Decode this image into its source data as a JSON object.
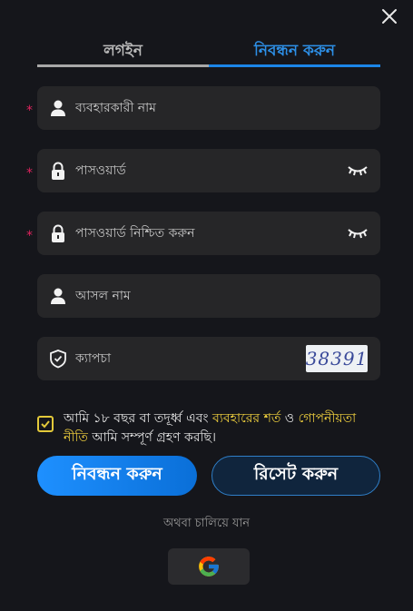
{
  "tabs": {
    "login": "লগইন",
    "register": "নিবন্ধন করুন"
  },
  "fields": {
    "username_placeholder": "ব্যবহারকারী নাম",
    "password_placeholder": "পাসওয়ার্ড",
    "confirm_password_placeholder": "পাসওয়ার্ড নিশ্চিত করুন",
    "real_name_placeholder": "আসল নাম",
    "captcha_placeholder": "ক্যাপচা",
    "captcha_code": "38391",
    "required_mark": "*"
  },
  "agreement": {
    "checked": true,
    "text_before": "আমি ১৮ বছর বা তদূর্ধ্ব এবং ",
    "terms_link": "ব্যবহারের শর্ত",
    "text_and": " ও ",
    "privacy_link_a": "গোপনীয়তা",
    "privacy_link_b": "নীতি",
    "text_after": " আমি সম্পূর্ণ গ্রহণ করছি।"
  },
  "buttons": {
    "register": "নিবন্ধন করুন",
    "reset": "রিসেট করুন"
  },
  "alt_login_text": "অথবা চালিয়ে যান",
  "colors": {
    "accent": "#1c86e8",
    "link": "#f2d23e",
    "required": "#e0245e",
    "field_bg": "#262628",
    "page_bg": "#15161b"
  },
  "icons": [
    "close-icon",
    "user-icon",
    "lock-icon",
    "eye-closed-icon",
    "shield-check-icon",
    "checkmark-icon",
    "google-icon"
  ]
}
